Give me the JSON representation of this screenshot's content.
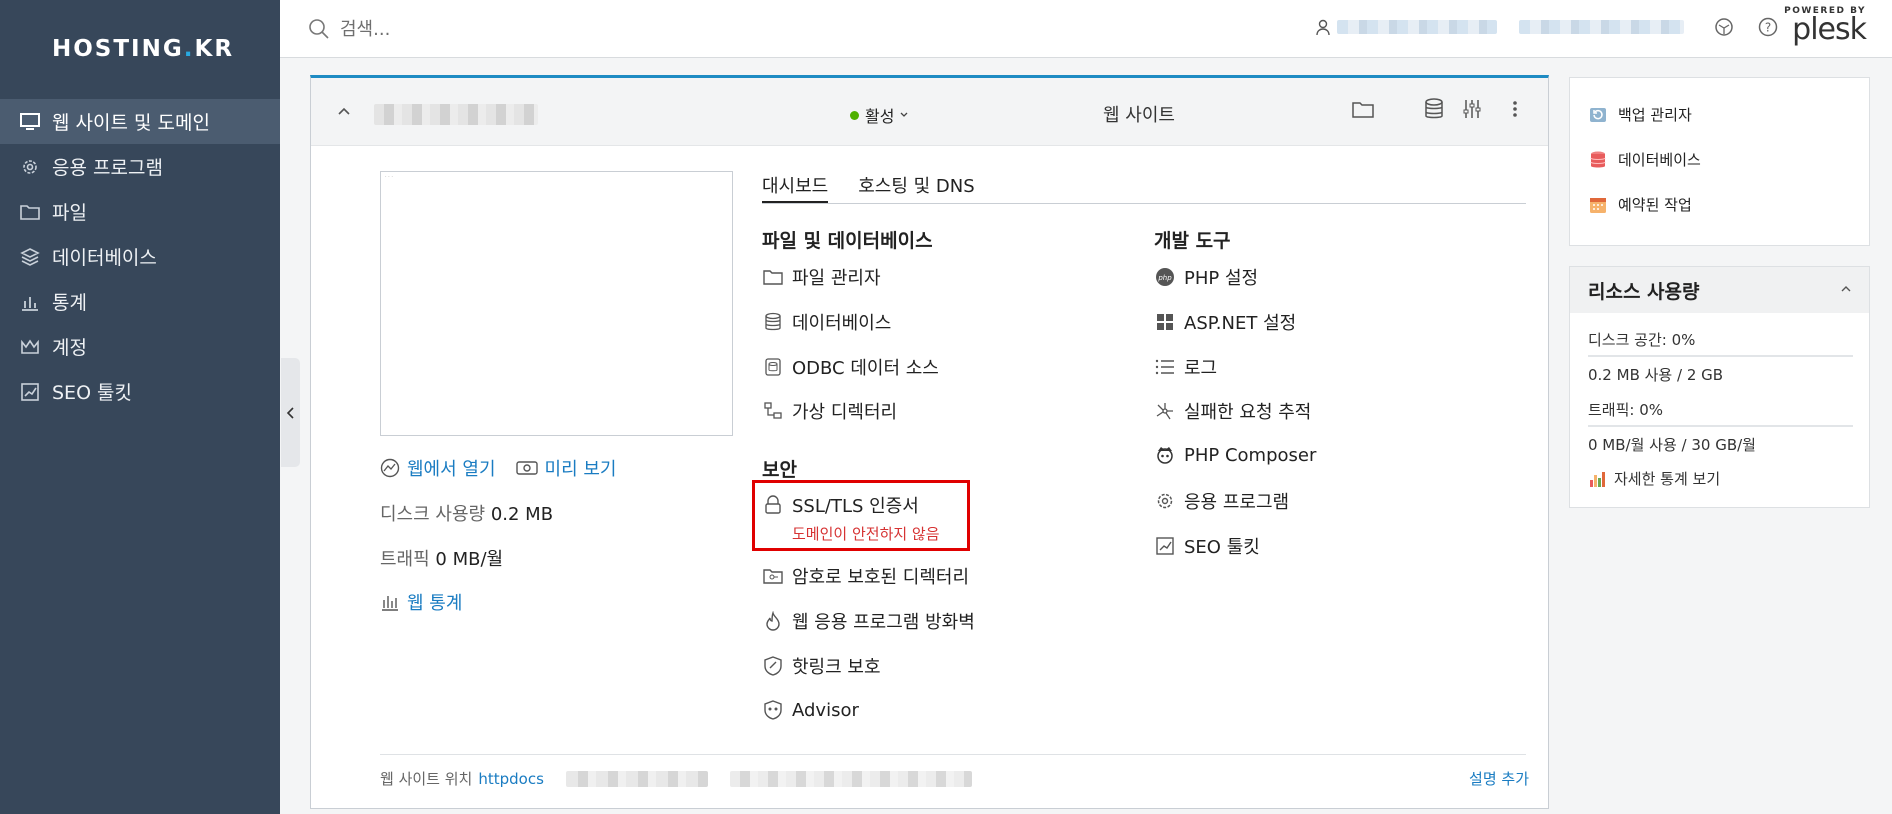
{
  "brand": {
    "logo_left": "HOSTING",
    "logo_dot": ".",
    "logo_right": "KR"
  },
  "sidebar": {
    "items": [
      {
        "label": "웹 사이트 및 도메인",
        "icon": "monitor-icon",
        "active": true
      },
      {
        "label": "응용 프로그램",
        "icon": "gear-icon"
      },
      {
        "label": "파일",
        "icon": "folder-icon"
      },
      {
        "label": "데이터베이스",
        "icon": "layers-icon"
      },
      {
        "label": "통계",
        "icon": "bar-chart-icon"
      },
      {
        "label": "계정",
        "icon": "crown-icon"
      },
      {
        "label": "SEO 툴킷",
        "icon": "trend-icon"
      }
    ]
  },
  "topbar": {
    "search_placeholder": "검색...",
    "powered_by": "POWERED BY",
    "plesk": "plesk"
  },
  "domain": {
    "status": "활성",
    "site_label": "웹 사이트",
    "open_in_web": "웹에서 열기",
    "preview": "미리 보기",
    "disk_label": "디스크 사용량",
    "disk_value": "0.2 MB",
    "traffic_label": "트래픽",
    "traffic_value": "0 MB/월",
    "web_stats": "웹 통계"
  },
  "tabs": [
    "대시보드",
    "호스팅 및 DNS"
  ],
  "sections": {
    "files_db": {
      "title": "파일 및 데이터베이스",
      "items": [
        "파일 관리자",
        "데이터베이스",
        "ODBC 데이터 소스",
        "가상 디렉터리"
      ]
    },
    "dev": {
      "title": "개발 도구",
      "items": [
        "PHP 설정",
        "ASP.NET 설정",
        "로그",
        "실패한 요청 추적",
        "PHP Composer",
        "응용 프로그램",
        "SEO 툴킷"
      ]
    },
    "security": {
      "title": "보안",
      "ssl": "SSL/TLS 인증서",
      "ssl_warning": "도메인이 안전하지 않음",
      "items": [
        "암호로 보호된 디렉터리",
        "웹 응용 프로그램 방화벽",
        "핫링크 보호",
        "Advisor"
      ]
    }
  },
  "footer": {
    "location_label": "웹 사이트 위치",
    "location_link": "httpdocs",
    "add_desc": "설명 추가"
  },
  "side": {
    "links": [
      "백업 관리자",
      "데이터베이스",
      "예약된 작업"
    ]
  },
  "resources": {
    "title": "리소스 사용량",
    "disk_label": "디스크 공간",
    "disk_percent": "0%",
    "disk_fraction": 0.0,
    "disk_usage": "0.2 MB 사용 / 2 GB",
    "traffic_label": "트래픽",
    "traffic_percent": "0%",
    "traffic_fraction": 0.0,
    "traffic_usage": "0 MB/월 사용 / 30 GB/월",
    "detail_link": "자세한 통계 보기"
  },
  "colors": {
    "sidebar": "#37475a",
    "accent": "#1a7cc2",
    "warning": "#d63333",
    "active": "#4fb000"
  }
}
